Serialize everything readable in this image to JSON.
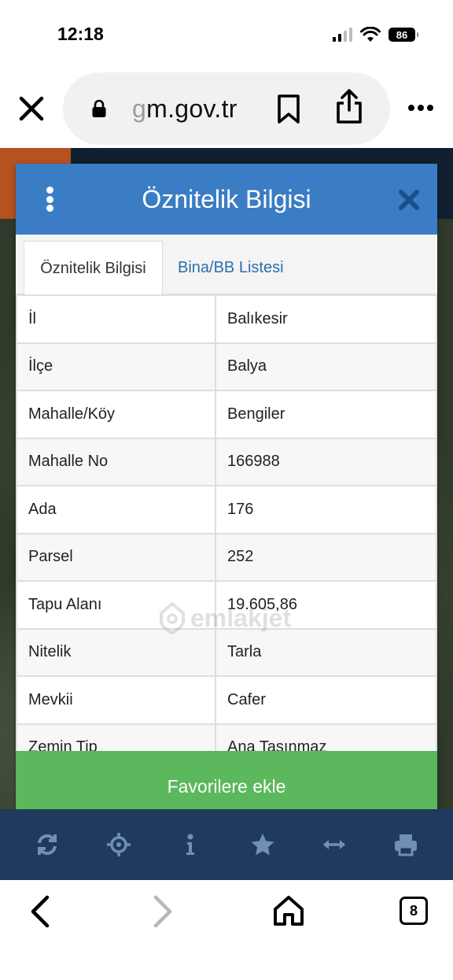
{
  "status_bar": {
    "time": "12:18",
    "battery": "86"
  },
  "browser": {
    "url_faded": "g",
    "url_main": "m.gov.tr"
  },
  "panel": {
    "title": "Öznitelik Bilgisi",
    "tabs": [
      {
        "label": "Öznitelik Bilgisi",
        "active": true
      },
      {
        "label": "Bina/BB Listesi",
        "active": false
      }
    ],
    "rows": [
      {
        "label": "İl",
        "value": "Balıkesir"
      },
      {
        "label": "İlçe",
        "value": "Balya"
      },
      {
        "label": "Mahalle/Köy",
        "value": "Bengiler"
      },
      {
        "label": "Mahalle No",
        "value": "166988"
      },
      {
        "label": "Ada",
        "value": "176"
      },
      {
        "label": "Parsel",
        "value": "252"
      },
      {
        "label": "Tapu Alanı",
        "value": "19.605,86"
      },
      {
        "label": "Nitelik",
        "value": "Tarla"
      },
      {
        "label": "Mevkii",
        "value": "Cafer"
      },
      {
        "label": "Zemin Tip",
        "value": "Ana Taşınmaz"
      }
    ],
    "favorite_button": "Favorilere ekle"
  },
  "watermark": "emlakjet",
  "bottom_nav": {
    "tab_count": "8"
  },
  "colors": {
    "header_blue": "#3a7dc4",
    "button_green": "#5cb85c",
    "toolbar_navy": "#1f3a5c",
    "tab_link_blue": "#2a6fae"
  },
  "icons": {
    "toolbar": [
      "refresh-icon",
      "locate-icon",
      "info-icon",
      "star-icon",
      "measure-icon",
      "print-icon"
    ]
  }
}
